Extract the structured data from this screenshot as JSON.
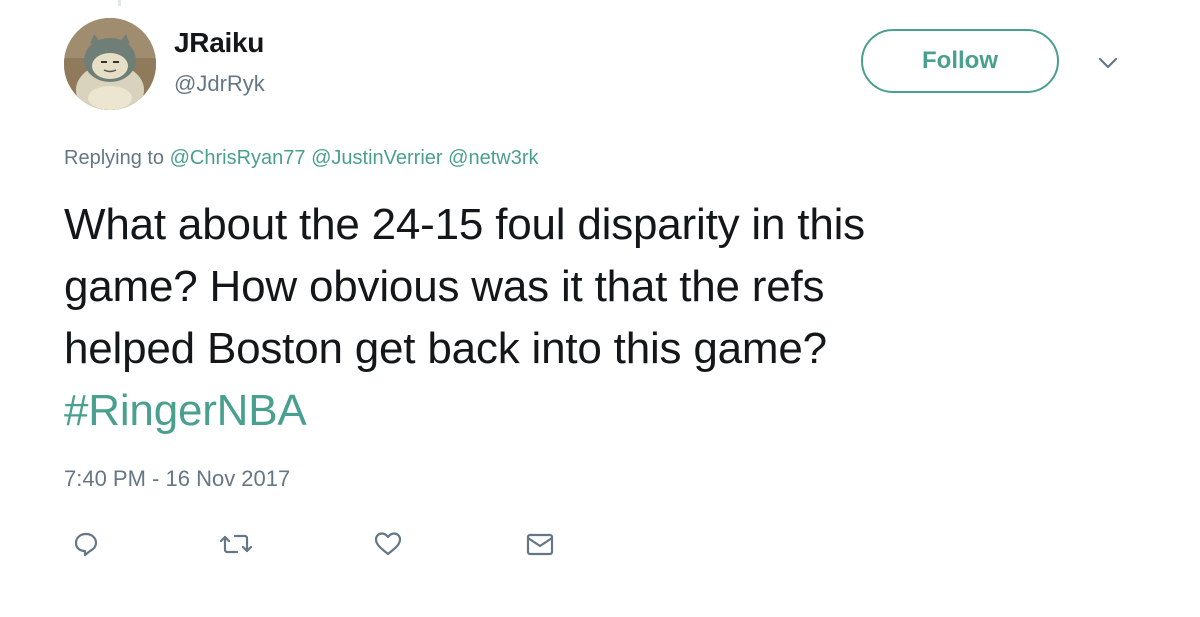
{
  "user": {
    "name": "JRaiku",
    "handle": "@JdrRyk",
    "avatar_icon": "snorlax-avatar"
  },
  "follow_label": "Follow",
  "caret_icon": "chevron-down-icon",
  "reply": {
    "prefix": "Replying to",
    "mentions": [
      "@ChrisRyan77",
      "@JustinVerrier",
      "@netw3rk"
    ]
  },
  "tweet": {
    "lines": [
      "What about the 24-15 foul disparity in this",
      "game? How obvious was it that the refs",
      "helped Boston get back into this game?"
    ],
    "hashtag": "#RingerNBA"
  },
  "timestamp": "7:40 PM - 16 Nov 2017",
  "actions": [
    {
      "icon": "reply-icon"
    },
    {
      "icon": "retweet-icon"
    },
    {
      "icon": "like-icon"
    },
    {
      "icon": "direct-message-icon"
    }
  ],
  "colors": {
    "accent": "#4aa08f",
    "secondary_text": "#657786",
    "primary_text": "#14171a"
  }
}
